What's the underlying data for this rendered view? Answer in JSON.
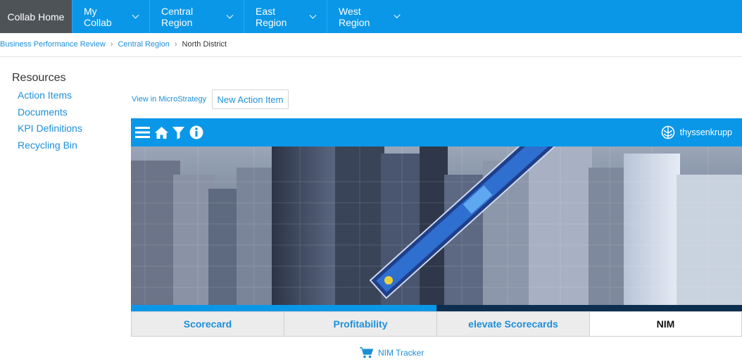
{
  "nav": {
    "home": "Collab Home",
    "my_collab": "My Collab",
    "central": "Central Region",
    "east": "East Region",
    "west": "West Region"
  },
  "breadcrumb": {
    "item1": "Business Performance Review",
    "item2": "Central Region",
    "current": "North District"
  },
  "sidebar": {
    "title": "Resources",
    "items": [
      {
        "label": "Action Items"
      },
      {
        "label": "Documents"
      },
      {
        "label": "KPI Definitions"
      },
      {
        "label": "Recycling Bin"
      }
    ]
  },
  "actions": {
    "view_link": "View in MicroStrategy",
    "new_button": "New Action Item"
  },
  "dashboard": {
    "brand": "thyssenkrupp",
    "icons": [
      "menu-icon",
      "home-icon",
      "filter-icon",
      "info-icon"
    ],
    "tabs": [
      {
        "label": "Scorecard"
      },
      {
        "label": "Profitability"
      },
      {
        "label": "elevate Scorecards"
      },
      {
        "label": "NIM",
        "active": true
      }
    ],
    "tracker_link": "NIM Tracker"
  },
  "colors": {
    "accent": "#0a97e8",
    "home_bg": "#4e5358",
    "link": "#1d8fd9"
  }
}
